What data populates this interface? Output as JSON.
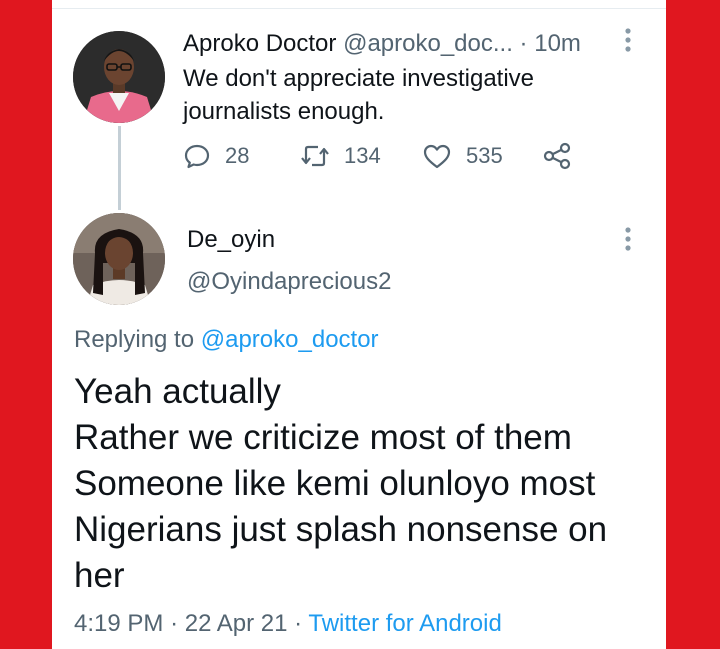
{
  "tweet1": {
    "author_name": "Aproko Doctor",
    "author_handle": "@aproko_doc...",
    "separator": "·",
    "time": "10m",
    "text": "We don't appreciate investigative journalists enough.",
    "reply_count": "28",
    "retweet_count": "134",
    "like_count": "535",
    "icons": [
      "reply-icon",
      "retweet-icon",
      "like-icon",
      "share-icon",
      "more-icon"
    ]
  },
  "tweet2": {
    "author_name": "De_oyin",
    "author_handle": "@Oyindaprecious2",
    "replying_prefix": "Replying to",
    "replying_to": "@aproko_doctor",
    "lines": [
      "Yeah actually",
      "Rather we criticize most of them",
      "Someone like kemi olunloyo most",
      "Nigerians just splash nonsense on",
      "her"
    ],
    "time": "4:19 PM",
    "sep": "·",
    "date": "22 Apr 21",
    "source": "Twitter for Android"
  },
  "colors": {
    "frame": "#e0171f",
    "link": "#1d9bf0",
    "muted": "#536471",
    "thread": "#c4cfd6"
  }
}
